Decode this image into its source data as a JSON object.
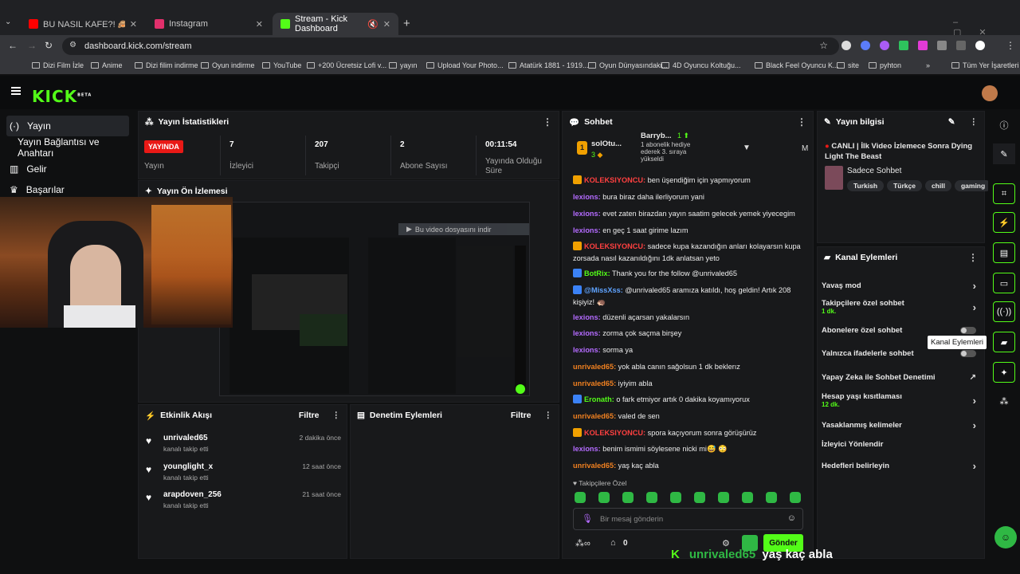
{
  "browser": {
    "tabs": [
      {
        "title": "BU NASIL KAFE?! 🙈 Klavyeler",
        "color": "#ff0000"
      },
      {
        "title": "Instagram",
        "color": "#e1306c"
      },
      {
        "title": "Stream - Kick Dashboard",
        "color": "#53fc18"
      }
    ],
    "new_tab": "+",
    "url": "dashboard.kick.com/stream",
    "bookmarks": [
      "Dizi Film İzle",
      "Anime",
      "Dizi filim indirme",
      "Oyun indirme",
      "YouTube",
      "+200 Ücretsiz Lofi v...",
      "yayın",
      "Upload Your Photo...",
      "Atatürk 1881 - 1919...",
      "Oyun Dünyasındaki...",
      "4D Oyuncu Koltuğu...",
      "Black Feel Oyuncu K...",
      "site",
      "pyhton"
    ],
    "bookmarks_more": "»",
    "all_bookmarks": "Tüm Yer İşaretleri"
  },
  "kick": {
    "logo": "KICK",
    "logo_beta": "BETA",
    "sidebar": [
      {
        "label": "Yayın",
        "icon": "broadcast-icon"
      },
      {
        "label": "Yayın Bağlantısı ve Anahtarı",
        "icon": ""
      },
      {
        "label": "Gelir",
        "icon": "chart-icon"
      },
      {
        "label": "Başarılar",
        "icon": "trophy-icon"
      }
    ]
  },
  "stats": {
    "title": "Yayın İstatistikleri",
    "live_badge": "YAYINDA",
    "live_label": "Yayın",
    "items": [
      {
        "value": "7",
        "label": "İzleyici"
      },
      {
        "value": "207",
        "label": "Takipçi"
      },
      {
        "value": "2",
        "label": "Abone Sayısı"
      },
      {
        "value": "00:11:54",
        "label": "Yayında Olduğu Süre"
      }
    ]
  },
  "preview": {
    "title": "Yayın Ön İzlemesi",
    "download_text": "Bu video dosyasını indir"
  },
  "activity": {
    "title": "Etkinlik Akışı",
    "filter": "Filtre",
    "events": [
      {
        "user": "unrivaled65",
        "action": "kanalı takip etti",
        "time": "2 dakika önce"
      },
      {
        "user": "younglight_x",
        "action": "kanalı takip etti",
        "time": "12 saat önce"
      },
      {
        "user": "arapdoven_256",
        "action": "kanalı takip etti",
        "time": "21 saat önce"
      }
    ]
  },
  "moderation": {
    "title": "Denetim Eylemleri",
    "filter": "Filtre"
  },
  "chat": {
    "title": "Sohbet",
    "gift_rank": "1",
    "gift_user": "solOtu...",
    "gift_count": "3",
    "gift_user2": "Barryb...",
    "gift_rank2": "1",
    "gift_text": "1 abonelik hediye ederek 3. sıraya yükseldi",
    "m_label": "M",
    "messages": [
      {
        "user": "KOLEKSIYONCU:",
        "text": " ben üşendiğim için yapmıyorum",
        "cls": "u3",
        "badge": "#f0a000"
      },
      {
        "user": "lexions:",
        "text": " bura biraz daha ilerliyorum yani",
        "cls": "u1",
        "badge": ""
      },
      {
        "user": "lexions:",
        "text": " evet zaten birazdan yayın saatim gelecek yemek yiyecegim",
        "cls": "u1",
        "badge": ""
      },
      {
        "user": "lexions:",
        "text": " en geç 1 saat girime lazım",
        "cls": "u1",
        "badge": ""
      },
      {
        "user": "KOLEKSIYONCU:",
        "text": " sadece kupa kazandığın anları kolayarsın kupa zorsada nasıl kazanıldığını 1dk anlatsan yeto",
        "cls": "u3",
        "badge": "#f0a000"
      },
      {
        "user": "BotRix:",
        "text": " Thank you for the follow @unrivaled65",
        "cls": "u4",
        "badge": "#3b82f6"
      },
      {
        "user": "@MissXss:",
        "text": " @unrivaled65 aramıza katıldı, hoş geldin! Artık 208 kişiyiz! 🦔",
        "cls": "u5",
        "badge": "#3b82f6"
      },
      {
        "user": "lexions:",
        "text": " düzenli açarsan yakalarsın",
        "cls": "u1",
        "badge": ""
      },
      {
        "user": "lexions:",
        "text": " zorma çok saçma birşey",
        "cls": "u1",
        "badge": ""
      },
      {
        "user": "lexions:",
        "text": " sorma ya",
        "cls": "u1",
        "badge": ""
      },
      {
        "user": "unrivaled65:",
        "text": " yok abla canın sağolsun 1 dk beklerız",
        "cls": "u2",
        "badge": ""
      },
      {
        "user": "unrivaled65:",
        "text": " iyiyim abla",
        "cls": "u2",
        "badge": ""
      },
      {
        "user": "Eronath:",
        "text": " o fark etmiyor artık 0 dakika koyamıyorux",
        "cls": "u4",
        "badge": "#3b82f6"
      },
      {
        "user": "unrivaled65:",
        "text": " valed de sen",
        "cls": "u2",
        "badge": ""
      },
      {
        "user": "KOLEKSIYONCU:",
        "text": " spora kaçıyorum sonra görüşürüz",
        "cls": "u3",
        "badge": "#f0a000"
      },
      {
        "user": "lexions:",
        "text": " benim ismimi söylesene nicki mi😅 😳",
        "cls": "u1",
        "badge": ""
      },
      {
        "user": "unrivaled65:",
        "text": " yaş kaç abla",
        "cls": "u2",
        "badge": ""
      }
    ],
    "followers_only": "Takipçilere Özel",
    "input_placeholder": "Bir mesaj gönderin",
    "points": "0",
    "send": "Gönder"
  },
  "info": {
    "title": "Yayın bilgisi",
    "stream_title": "CANLI | İlk Video İzlemece Sonra Dying Light The Beast",
    "category": "Sadece Sohbet",
    "tags": [
      "Turkish",
      "Türkçe",
      "chill",
      "gaming"
    ]
  },
  "actions": {
    "title": "Kanal Eylemleri",
    "tooltip": "Kanal Eylemleri",
    "items": [
      {
        "label": "Yavaş mod",
        "sub": ""
      },
      {
        "label": "Takipçilere özel sohbet",
        "sub": "1 dk."
      },
      {
        "label": "Abonelere özel sohbet",
        "sub": ""
      },
      {
        "label": "Yalnızca ifadelerle sohbet",
        "sub": ""
      },
      {
        "label": "Yapay Zeka ile Sohbet Denetimi",
        "sub": ""
      },
      {
        "label": "Hesap yaşı kısıtlaması",
        "sub": "12 dk."
      },
      {
        "label": "Yasaklanmış kelimeler",
        "sub": ""
      },
      {
        "label": "İzleyici Yönlendir",
        "sub": ""
      },
      {
        "label": "Hedefleri belirleyin",
        "sub": ""
      }
    ]
  },
  "overlay": {
    "user": "unrivaled65",
    "text": "yaş kaç abla"
  }
}
